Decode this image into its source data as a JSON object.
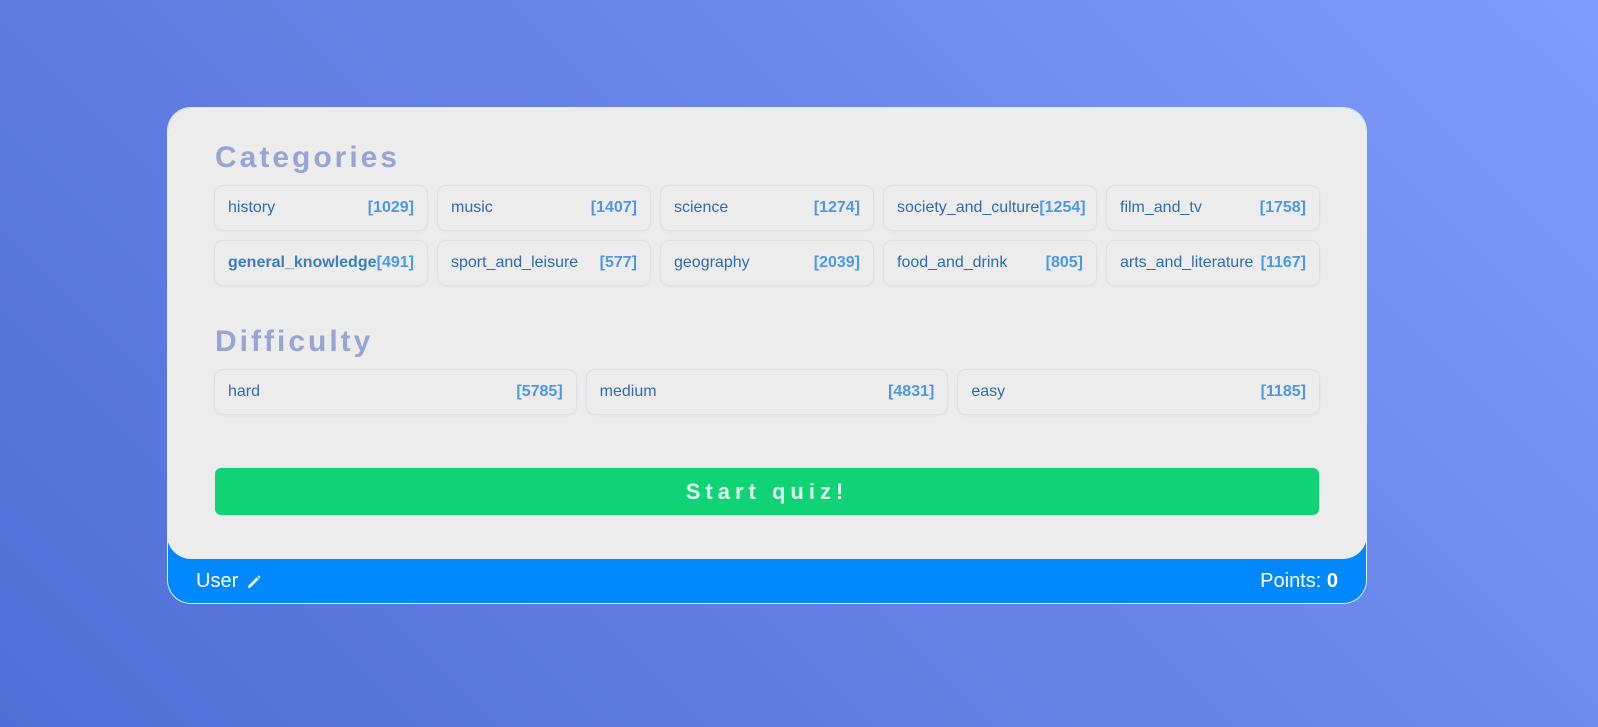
{
  "categories": {
    "title": "Categories",
    "items": [
      {
        "name": "history",
        "count": "[1029]"
      },
      {
        "name": "music",
        "count": "[1407]"
      },
      {
        "name": "science",
        "count": "[1274]"
      },
      {
        "name": "society_and_culture",
        "count": "[1254]"
      },
      {
        "name": "film_and_tv",
        "count": "[1758]"
      },
      {
        "name": "general_knowledge",
        "count": "[491]"
      },
      {
        "name": "sport_and_leisure",
        "count": "[577]"
      },
      {
        "name": "geography",
        "count": "[2039]"
      },
      {
        "name": "food_and_drink",
        "count": "[805]"
      },
      {
        "name": "arts_and_literature",
        "count": "[1167]"
      }
    ]
  },
  "difficulty": {
    "title": "Difficulty",
    "items": [
      {
        "name": "hard",
        "count": "[5785]"
      },
      {
        "name": "medium",
        "count": "[4831]"
      },
      {
        "name": "easy",
        "count": "[1185]"
      }
    ]
  },
  "start_label": "Start quiz!",
  "footer": {
    "user_label": "User",
    "user_icon": "pencil-icon",
    "points_label": "Points:",
    "points_value": "0"
  },
  "colors": {
    "accent_green": "#0fd374",
    "footer_blue": "#0088ff",
    "title_color": "#96a4d6"
  }
}
